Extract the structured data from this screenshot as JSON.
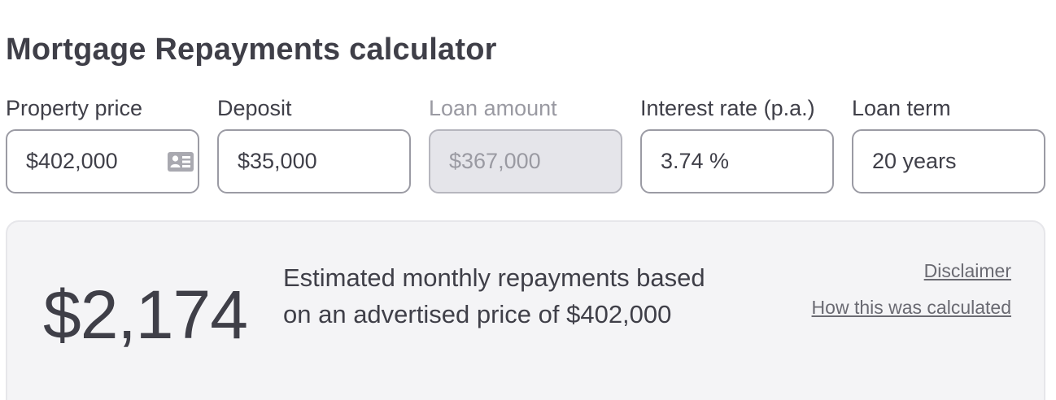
{
  "title": "Mortgage Repayments calculator",
  "fields": [
    {
      "label": "Property price",
      "value": "$402,000",
      "icon": "contact-card-icon"
    },
    {
      "label": "Deposit",
      "value": "$35,000"
    },
    {
      "label": "Loan amount",
      "value": "$367,000",
      "disabled": true
    },
    {
      "label": "Interest rate (p.a.)",
      "value": "3.74 %"
    },
    {
      "label": "Loan term",
      "value": "20 years"
    }
  ],
  "result": {
    "amount": "$2,174",
    "description": "Estimated monthly repayments based on an advertised price of $402,000",
    "disclaimer_link": "Disclaimer",
    "how_link": "How this was calculated"
  },
  "colors": {
    "text": "#3f3f48",
    "disabled_text": "#9a9aa2",
    "disabled_bg": "#e5e5ea",
    "panel_bg": "#f4f4f6",
    "border": "#9b9ba4"
  }
}
